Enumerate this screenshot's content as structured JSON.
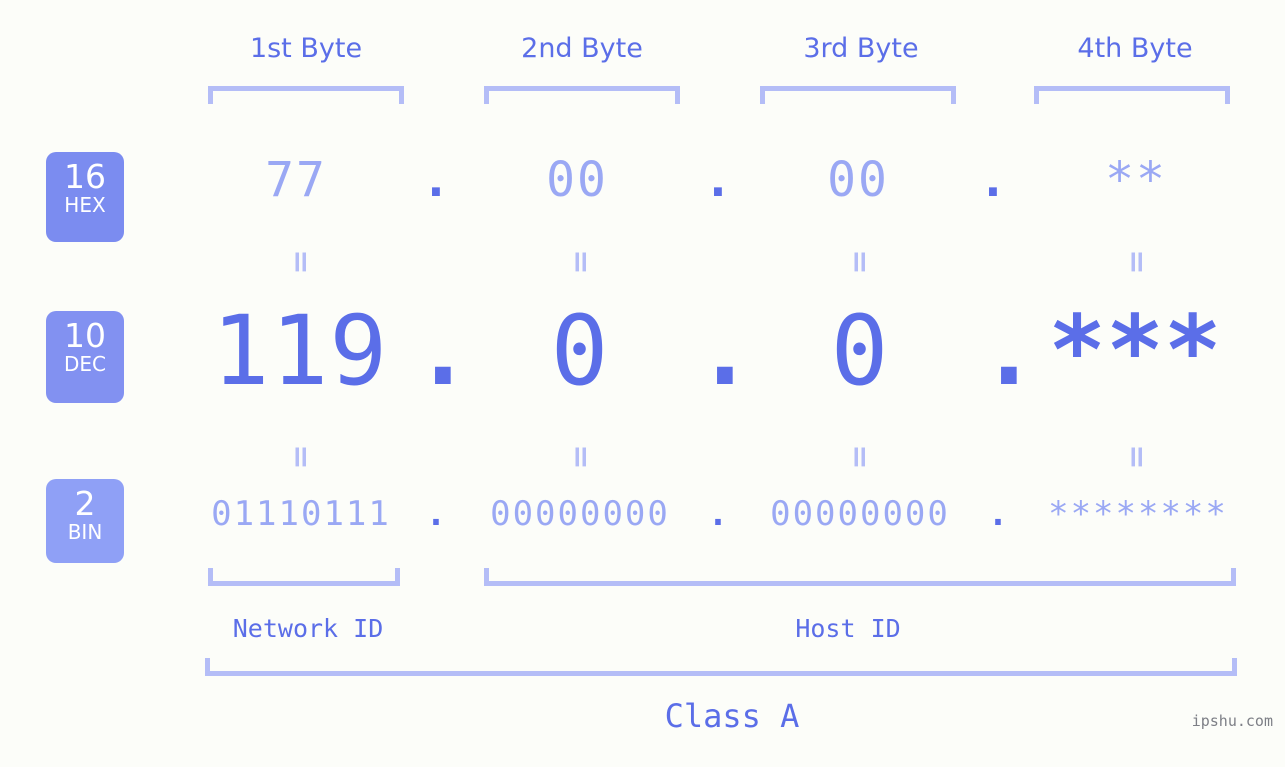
{
  "watermark": "ipshu.com",
  "columns": [
    {
      "label": "1st Byte"
    },
    {
      "label": "2nd Byte"
    },
    {
      "label": "3rd Byte"
    },
    {
      "label": "4th Byte"
    }
  ],
  "bases": [
    {
      "number": "16",
      "name": "HEX",
      "color": "#7b8cf0"
    },
    {
      "number": "10",
      "name": "DEC",
      "color": "#8291f1"
    },
    {
      "number": "2",
      "name": "BIN",
      "color": "#8fa0f6"
    }
  ],
  "rows": {
    "hex": {
      "values": [
        "77",
        "00",
        "00",
        "**"
      ]
    },
    "dec": {
      "values": [
        "119",
        "0",
        "0",
        "***"
      ]
    },
    "bin": {
      "values": [
        "01110111",
        "00000000",
        "00000000",
        "********"
      ]
    }
  },
  "separators": {
    "dot": ".",
    "equals": "="
  },
  "sections": [
    {
      "label": "Network ID"
    },
    {
      "label": "Host ID"
    }
  ],
  "class": {
    "label": "Class A"
  },
  "colors": {
    "background": "#fcfdf9",
    "accent": "#5b6ee8",
    "accent_light": "#9aa8f4",
    "bracket": "#b4bdf7",
    "badge": "#7b8cf0"
  }
}
